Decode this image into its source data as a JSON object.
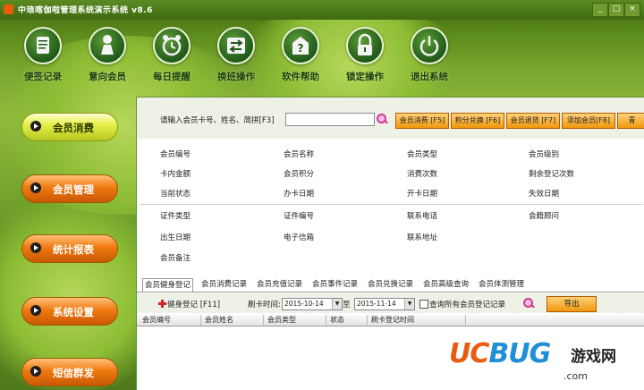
{
  "window": {
    "title": "中琅喀伽啦管理系统演示系统  v8.6",
    "controls": [
      "_",
      "□",
      "×"
    ]
  },
  "toolbar": [
    {
      "label": "便签记录",
      "icon": "notepad-icon"
    },
    {
      "label": "意向会员",
      "icon": "member-icon"
    },
    {
      "label": "每日提醒",
      "icon": "alarm-clock-icon"
    },
    {
      "label": "换班操作",
      "icon": "shift-swap-icon"
    },
    {
      "label": "软件帮助",
      "icon": "help-icon"
    },
    {
      "label": "锁定操作",
      "icon": "lock-icon"
    },
    {
      "label": "退出系统",
      "icon": "power-icon"
    }
  ],
  "sidebar": [
    {
      "label": "会员消费",
      "style": "yellow"
    },
    {
      "label": "会员管理",
      "style": "orange"
    },
    {
      "label": "统计报表",
      "style": "orange"
    },
    {
      "label": "系统设置",
      "style": "orange"
    },
    {
      "label": "短信群发",
      "style": "orange"
    }
  ],
  "search": {
    "label": "请输入会员卡号、姓名、简拼[F3]",
    "value": ""
  },
  "action_buttons": [
    {
      "label": "会员消费 [F5]"
    },
    {
      "label": "积分兑换 [F6]"
    },
    {
      "label": "会员退货 [F7]"
    },
    {
      "label": "添加会员[F8]"
    },
    {
      "label": "青"
    }
  ],
  "info_fields": [
    [
      "会员编号",
      "会员名称",
      "会员类型",
      "会员级别"
    ],
    [
      "卡内金额",
      "会员积分",
      "消费次数",
      "剩余登记次数"
    ],
    [
      "当前状态",
      "办卡日期",
      "开卡日期",
      "失效日期"
    ],
    [
      "证件类型",
      "证件编号",
      "联系电话",
      "会籍顾问"
    ],
    [
      "出生日期",
      "电子信箱",
      "联系地址"
    ],
    [
      "会员备注"
    ]
  ],
  "tabs": [
    "会员健身登记",
    "会员消费记录",
    "会员充值记录",
    "会员事件记录",
    "会员兑换记录",
    "会员高级查询",
    "会员体测管理"
  ],
  "subtoolbar": {
    "register_label": "健身登记 [F11]",
    "time_label": "刷卡时间:",
    "date_from": "2015-10-14",
    "to_label": "至",
    "date_to": "2015-11-14",
    "query_all_label": "查询所有会员登记记录",
    "export_label": "导出"
  },
  "grid_columns": [
    "会员编号",
    "会员姓名",
    "会员类型",
    "状态",
    "刷卡登记时间"
  ],
  "watermark": {
    "logo_uc": "UC",
    "logo_bug": "BUG",
    "cn": "游戏网",
    "url": ".com"
  },
  "colors": {
    "bg_green": "#78a630",
    "button_orange": "#f0970b",
    "sidebar_orange": "#f07a10",
    "sidebar_yellow": "#e8f04a"
  }
}
